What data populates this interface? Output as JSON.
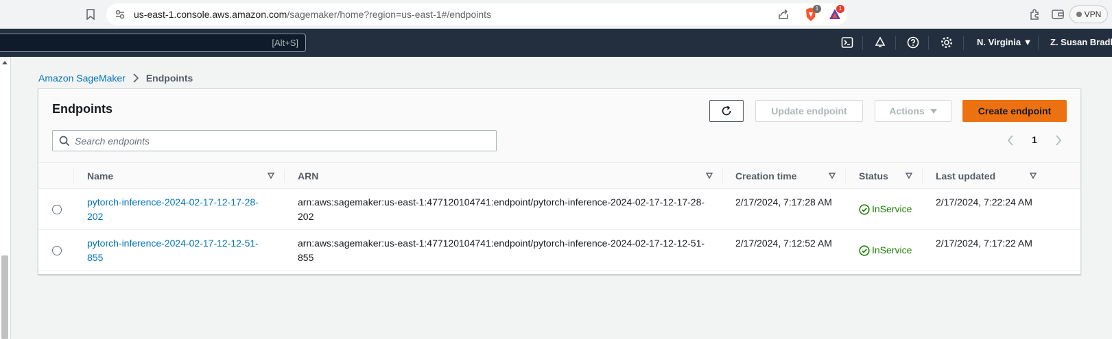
{
  "browser": {
    "url_host": "us-east-1.console.aws.amazon.com",
    "url_path": "/sagemaker/home?region=us-east-1#/endpoints",
    "brave_badge": "1",
    "rewards_badge": "1",
    "vpn_label": "VPN"
  },
  "aws_nav": {
    "search_shortcut": "[Alt+S]",
    "region": "N. Virginia ▼",
    "account": "Z. Susan Bradley"
  },
  "breadcrumb": {
    "root": "Amazon SageMaker",
    "current": "Endpoints"
  },
  "panel": {
    "title": "Endpoints",
    "update_label": "Update endpoint",
    "actions_label": "Actions",
    "create_label": "Create endpoint",
    "search_placeholder": "Search endpoints",
    "page": "1"
  },
  "table": {
    "columns": [
      "Name",
      "ARN",
      "Creation time",
      "Status",
      "Last updated"
    ],
    "rows": [
      {
        "name": "pytorch-inference-2024-02-17-12-17-28-202",
        "arn": "arn:aws:sagemaker:us-east-1:477120104741:endpoint/pytorch-inference-2024-02-17-12-17-28-202",
        "created": "2/17/2024, 7:17:28 AM",
        "status": "InService",
        "updated": "2/17/2024, 7:22:24 AM"
      },
      {
        "name": "pytorch-inference-2024-02-17-12-12-51-855",
        "arn": "arn:aws:sagemaker:us-east-1:477120104741:endpoint/pytorch-inference-2024-02-17-12-12-51-855",
        "created": "2/17/2024, 7:12:52 AM",
        "status": "InService",
        "updated": "2/17/2024, 7:17:22 AM"
      }
    ]
  },
  "colors": {
    "aws_nav_bg": "#232f3e",
    "link": "#0073bb",
    "primary_button": "#ec7211",
    "status_success": "#1d8102"
  }
}
